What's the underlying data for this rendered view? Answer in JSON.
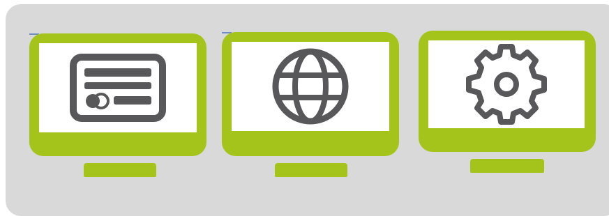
{
  "colors": {
    "panel_background": "#d9d9d9",
    "monitor_frame": "#a5c41b",
    "screen": "#ffffff",
    "icon": "#58585a"
  },
  "monitors": [
    {
      "icon": "credit-card-icon"
    },
    {
      "icon": "globe-icon"
    },
    {
      "icon": "gear-icon"
    }
  ]
}
